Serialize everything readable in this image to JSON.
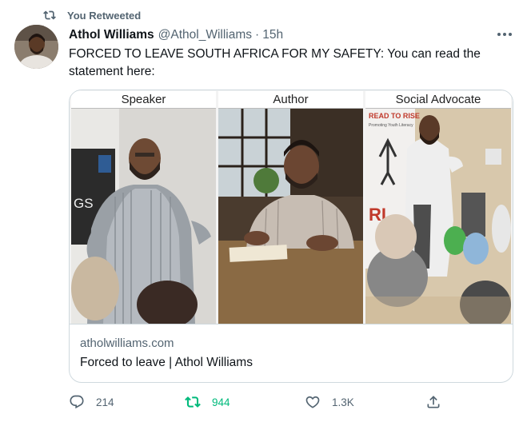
{
  "retweet_banner": {
    "label": "You Retweeted",
    "icon": "retweet-icon"
  },
  "author": {
    "name": "Athol Williams",
    "handle": "@Athol_Williams",
    "separator": "·",
    "time": "15h"
  },
  "tweet_text": "FORCED TO LEAVE SOUTH AFRICA FOR MY SAFETY: You can read the statement here:",
  "link_card": {
    "panels": [
      {
        "label": "Speaker"
      },
      {
        "label": "Author"
      },
      {
        "label": "Social Advocate"
      }
    ],
    "photo_texts": {
      "logo_fragment": "GS",
      "banner_title": "READ TO RISE",
      "banner_sub": "Promoting Youth Literacy",
      "banner_letters": "RI"
    },
    "domain": "atholwilliams.com",
    "title": "Forced to leave | Athol Williams"
  },
  "actions": {
    "reply": {
      "icon": "reply-icon",
      "count": "214"
    },
    "retweet": {
      "icon": "retweet-icon",
      "count": "944",
      "active": true,
      "color": "#00ba7c"
    },
    "like": {
      "icon": "heart-icon",
      "count": "1.3K"
    },
    "share": {
      "icon": "share-icon"
    }
  },
  "colors": {
    "secondary_text": "#536471",
    "primary_text": "#0f1419",
    "border": "#cfd9de",
    "retweet_green": "#00ba7c"
  }
}
